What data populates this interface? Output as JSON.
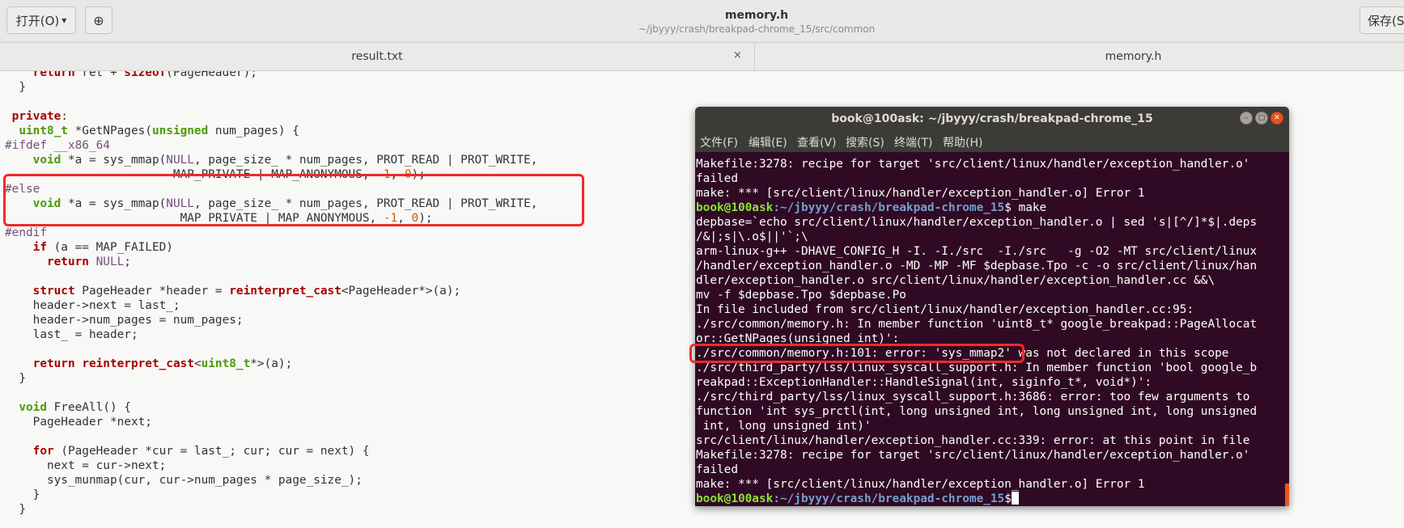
{
  "header": {
    "open_label": "打开(O)",
    "open_arrow": "▾",
    "new_icon": "⊕",
    "title": "memory.h",
    "subtitle": "~/jbyyy/crash/breakpad-chrome_15/src/common",
    "save_label": "保存(S"
  },
  "tabs": [
    {
      "label": "result.txt",
      "close": "×"
    },
    {
      "label": "memory.h"
    }
  ],
  "terminal": {
    "title": "book@100ask: ~/jbyyy/crash/breakpad-chrome_15",
    "buttons": {
      "minimize": "‒",
      "maximize": "□",
      "close": "✕"
    },
    "menu": [
      "文件(F)",
      "编辑(E)",
      "查看(V)",
      "搜索(S)",
      "终端(T)",
      "帮助(H)"
    ],
    "prompt_user": "book@100ask",
    "prompt_path": ":~/jbyyy/crash/breakpad-chrome_15",
    "prompt_symbol": "$",
    "command": " make",
    "lines_a": [
      "Makefile:3278: recipe for target 'src/client/linux/handler/exception_handler.o'",
      "failed",
      "make: *** [src/client/linux/handler/exception_handler.o] Error 1"
    ],
    "lines_b": [
      "depbase=`echo src/client/linux/handler/exception_handler.o | sed 's|[^/]*$|.deps",
      "/&|;s|\\.o$||'`;\\",
      "arm-linux-g++ -DHAVE_CONFIG_H -I. -I./src  -I./src   -g -O2 -MT src/client/linux",
      "/handler/exception_handler.o -MD -MP -MF $depbase.Tpo -c -o src/client/linux/han",
      "dler/exception_handler.o src/client/linux/handler/exception_handler.cc &&\\",
      "mv -f $depbase.Tpo $depbase.Po",
      "In file included from src/client/linux/handler/exception_handler.cc:95:",
      "./src/common/memory.h: In member function 'uint8_t* google_breakpad::PageAllocat",
      "or::GetNPages(unsigned int)':",
      "./src/common/memory.h:101: error: 'sys_mmap2' was not declared in this scope",
      "./src/third_party/lss/linux_syscall_support.h: In member function 'bool google_b",
      "reakpad::ExceptionHandler::HandleSignal(int, siginfo_t*, void*)':",
      "./src/third_party/lss/linux_syscall_support.h:3686: error: too few arguments to",
      "function 'int sys_prctl(int, long unsigned int, long unsigned int, long unsigned",
      " int, long unsigned int)'",
      "src/client/linux/handler/exception_handler.cc:339: error: at this point in file",
      "Makefile:3278: recipe for target 'src/client/linux/handler/exception_handler.o'",
      "failed",
      "make: *** [src/client/linux/handler/exception_handler.o] Error 1"
    ]
  },
  "code": [
    [
      [
        "    ",
        ""
      ],
      [
        "return",
        "kw"
      ],
      [
        " ret + ",
        ""
      ],
      [
        "sizeof",
        "kw"
      ],
      [
        "(PageHeader);",
        ""
      ]
    ],
    [
      [
        "  }",
        ""
      ]
    ],
    [
      [
        "",
        ""
      ]
    ],
    [
      [
        " ",
        ""
      ],
      [
        "private",
        "kw"
      ],
      [
        ":",
        ""
      ]
    ],
    [
      [
        "  ",
        ""
      ],
      [
        "uint8_t",
        "ty"
      ],
      [
        " *GetNPages(",
        ""
      ],
      [
        "unsigned",
        "ty"
      ],
      [
        " num_pages) {",
        ""
      ]
    ],
    [
      [
        "#ifdef __x86_64",
        "pp"
      ]
    ],
    [
      [
        "    ",
        ""
      ],
      [
        "void",
        "ty"
      ],
      [
        " *a = sys_mmap(",
        ""
      ],
      [
        "NULL",
        "pp"
      ],
      [
        ", page_size_ * num_pages, PROT_READ | PROT_WRITE,",
        ""
      ]
    ],
    [
      [
        "                        MAP_PRIVATE | MAP_ANONYMOUS, ",
        ""
      ],
      [
        "-1",
        "nu"
      ],
      [
        ", ",
        ""
      ],
      [
        "0",
        "nu"
      ],
      [
        ");",
        ""
      ]
    ],
    [
      [
        "#else",
        "pp"
      ]
    ],
    [
      [
        "    ",
        ""
      ],
      [
        "void",
        "ty"
      ],
      [
        " *a = sys_mmap(",
        ""
      ],
      [
        "NULL",
        "pp"
      ],
      [
        ", page_size_ * num_pages, PROT_READ | PROT_WRITE,",
        ""
      ]
    ],
    [
      [
        "                         MAP_PRIVATE | MAP_ANONYMOUS, ",
        ""
      ],
      [
        "-1",
        "nu"
      ],
      [
        ", ",
        ""
      ],
      [
        "0",
        "nu"
      ],
      [
        ");",
        ""
      ]
    ],
    [
      [
        "#endif",
        "pp"
      ]
    ],
    [
      [
        "    ",
        ""
      ],
      [
        "if",
        "kw"
      ],
      [
        " (a == MAP_FAILED)",
        ""
      ]
    ],
    [
      [
        "      ",
        ""
      ],
      [
        "return",
        "kw"
      ],
      [
        " ",
        ""
      ],
      [
        "NULL",
        "pp"
      ],
      [
        ";",
        ""
      ]
    ],
    [
      [
        "",
        ""
      ]
    ],
    [
      [
        "    ",
        ""
      ],
      [
        "struct",
        "kw"
      ],
      [
        " PageHeader *header = ",
        ""
      ],
      [
        "reinterpret_cast",
        "kw"
      ],
      [
        "<PageHeader*>(a);",
        ""
      ]
    ],
    [
      [
        "    header->next = last_;",
        ""
      ]
    ],
    [
      [
        "    header->num_pages = num_pages;",
        ""
      ]
    ],
    [
      [
        "    last_ = header;",
        ""
      ]
    ],
    [
      [
        "",
        ""
      ]
    ],
    [
      [
        "    ",
        ""
      ],
      [
        "return",
        "kw"
      ],
      [
        " ",
        ""
      ],
      [
        "reinterpret_cast",
        "kw"
      ],
      [
        "<",
        ""
      ],
      [
        "uint8_t",
        "ty"
      ],
      [
        "*>(a);",
        ""
      ]
    ],
    [
      [
        "  }",
        ""
      ]
    ],
    [
      [
        "",
        ""
      ]
    ],
    [
      [
        "  ",
        ""
      ],
      [
        "void",
        "ty"
      ],
      [
        " FreeAll() {",
        ""
      ]
    ],
    [
      [
        "    PageHeader *next;",
        ""
      ]
    ],
    [
      [
        "",
        ""
      ]
    ],
    [
      [
        "    ",
        ""
      ],
      [
        "for",
        "kw"
      ],
      [
        " (PageHeader *cur = last_; cur; cur = next) {",
        ""
      ]
    ],
    [
      [
        "      next = cur->next;",
        ""
      ]
    ],
    [
      [
        "      sys_munmap(cur, cur->num_pages * page_size_);",
        ""
      ]
    ],
    [
      [
        "    }",
        ""
      ]
    ],
    [
      [
        "  }",
        ""
      ]
    ]
  ]
}
